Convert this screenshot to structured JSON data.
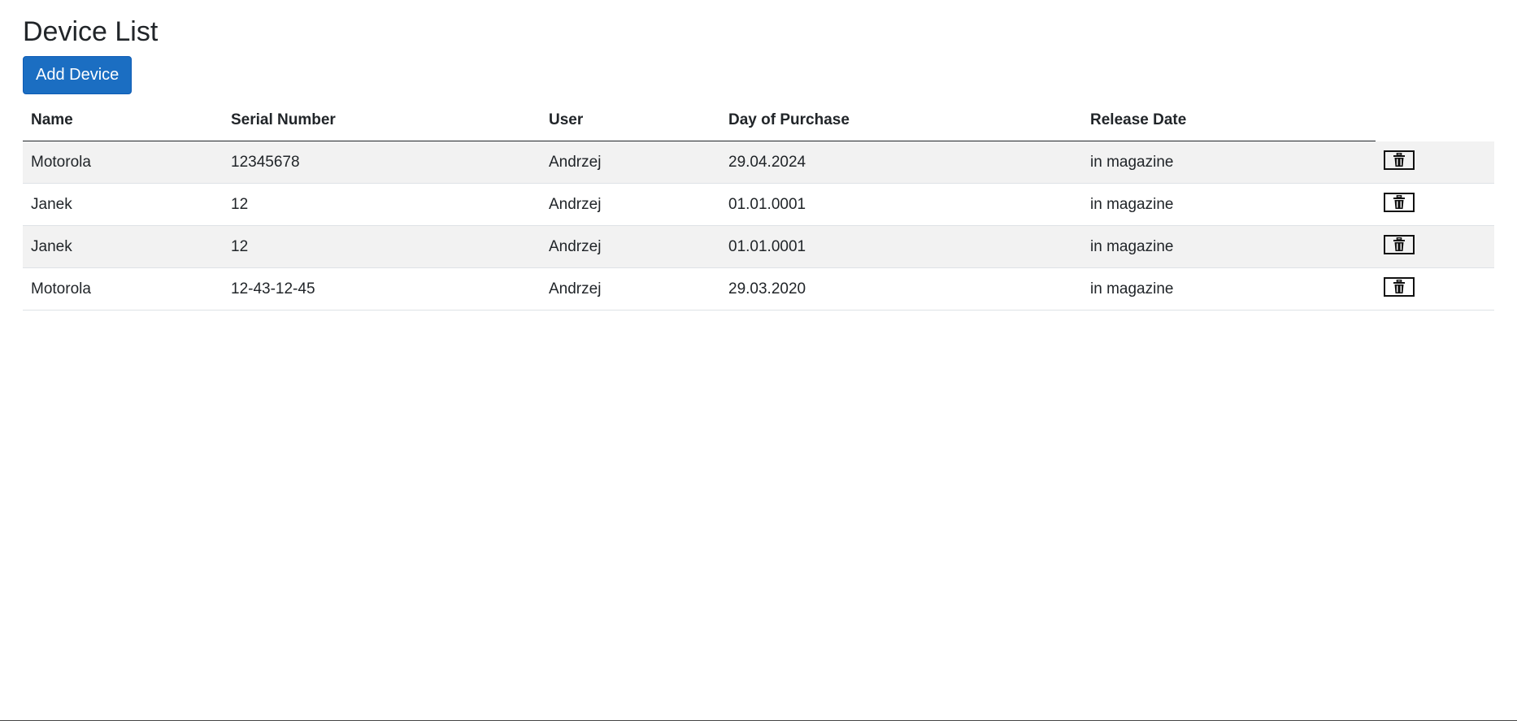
{
  "page": {
    "title": "Device List",
    "add_button_label": "Add Device"
  },
  "table": {
    "headers": {
      "name": "Name",
      "serial": "Serial Number",
      "user": "User",
      "purchase": "Day of Purchase",
      "release": "Release Date"
    },
    "rows": [
      {
        "name": "Motorola",
        "serial": "12345678",
        "user": "Andrzej",
        "purchase": "29.04.2024",
        "release": "in magazine"
      },
      {
        "name": "Janek",
        "serial": "12",
        "user": "Andrzej",
        "purchase": "01.01.0001",
        "release": "in magazine"
      },
      {
        "name": "Janek",
        "serial": "12",
        "user": "Andrzej",
        "purchase": "01.01.0001",
        "release": "in magazine"
      },
      {
        "name": "Motorola",
        "serial": "12-43-12-45",
        "user": "Andrzej",
        "purchase": "29.03.2020",
        "release": "in magazine"
      }
    ],
    "row_action_icon": "trash-icon"
  },
  "colors": {
    "primary_button": "#1b6ec2",
    "stripe": "#f2f2f2",
    "text": "#212529"
  }
}
